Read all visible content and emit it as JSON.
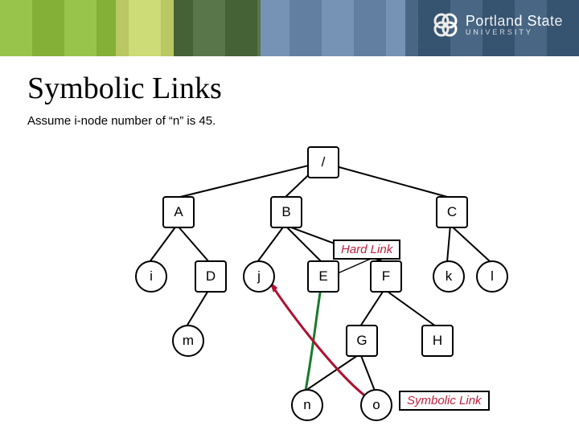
{
  "brand": {
    "name": "Portland State",
    "sub": "UNIVERSITY"
  },
  "slide": {
    "title": "Symbolic Links",
    "subtitle": "Assume i-node number of “n” is 45."
  },
  "nodes": {
    "root": "/",
    "A": "A",
    "B": "B",
    "C": "C",
    "i": "i",
    "D": "D",
    "j": "j",
    "E": "E",
    "F": "F",
    "k": "k",
    "l": "l",
    "m": "m",
    "G": "G",
    "H": "H",
    "n": "n",
    "o": "o"
  },
  "annotations": {
    "hard_link": "Hard Link",
    "symbolic_link": "Symbolic Link"
  }
}
